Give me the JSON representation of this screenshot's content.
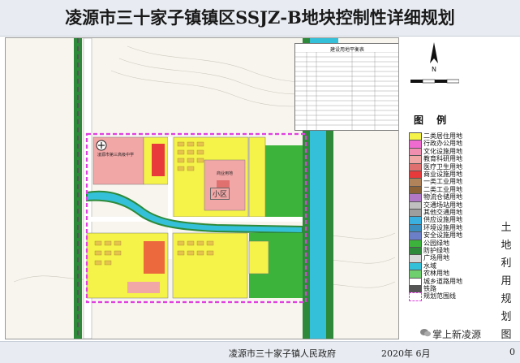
{
  "title": "凌源市三十家子镇镇区SSJZ-B地块控制性详细规划",
  "footer": {
    "organization": "凌源市三十家子镇人民政府",
    "date": "2020年  6月",
    "page": "0"
  },
  "side_title": "土地利用规划图",
  "legend": {
    "title": "图  例",
    "items": [
      {
        "label": "二类居住用地",
        "color": "#f5f24a"
      },
      {
        "label": "行政办公用地",
        "color": "#f06bd0"
      },
      {
        "label": "文化设施用地",
        "color": "#f08fb0"
      },
      {
        "label": "教育科研用地",
        "color": "#f2a7a7"
      },
      {
        "label": "医疗卫生用地",
        "color": "#e07070"
      },
      {
        "label": "商业设施用地",
        "color": "#e83a3a"
      },
      {
        "label": "一类工业用地",
        "color": "#b0835a"
      },
      {
        "label": "二类工业用地",
        "color": "#8c6239"
      },
      {
        "label": "物流仓储用地",
        "color": "#b278c8"
      },
      {
        "label": "交通场站用地",
        "color": "#c0c0c0"
      },
      {
        "label": "其他交通用地",
        "color": "#9e9e9e"
      },
      {
        "label": "供应设施用地",
        "color": "#3ab0e0"
      },
      {
        "label": "环境设施用地",
        "color": "#3a8fc0"
      },
      {
        "label": "安全设施用地",
        "color": "#6a7fc8"
      },
      {
        "label": "公园绿地",
        "color": "#3cb43c"
      },
      {
        "label": "防护绿地",
        "color": "#2e8a3a"
      },
      {
        "label": "广场用地",
        "color": "#d8d8d8"
      },
      {
        "label": "水域",
        "color": "#34c0d8"
      },
      {
        "label": "农林用地",
        "color": "#6fcf6f"
      },
      {
        "label": "城乡道路用地",
        "color": "#ffffff"
      },
      {
        "label": "铁路",
        "color": "#555555"
      },
      {
        "label": "规划范围线",
        "color": "#e040e0"
      }
    ]
  },
  "stat_table": {
    "title": "建设用地平衡表"
  },
  "map_labels": {
    "school": "凌源市第三高级中学",
    "commercial": "商业用地",
    "district": "小区"
  },
  "watermark": "掌上新凌源",
  "colors": {
    "residential": "#f5f24a",
    "park": "#3cb43c",
    "water": "#34c0d8",
    "boundary": "#e040e0",
    "road": "#ffffff",
    "rail": "#555555"
  }
}
